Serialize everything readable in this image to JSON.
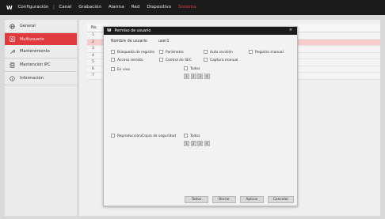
{
  "topbar": {
    "logo": "W",
    "nav": [
      {
        "label": "Configuración",
        "active": false
      },
      {
        "label": "Canal",
        "active": false
      },
      {
        "label": "Grabación",
        "active": false
      },
      {
        "label": "Alarma",
        "active": false
      },
      {
        "label": "Red",
        "active": false
      },
      {
        "label": "Dispositivo",
        "active": false
      },
      {
        "label": "Sistema",
        "active": true
      }
    ]
  },
  "sidebar": {
    "items": [
      {
        "label": "General",
        "icon": "globe-icon"
      },
      {
        "label": "Multiusuario",
        "icon": "user-icon",
        "active": true
      },
      {
        "label": "Mantenimiento",
        "icon": "wrench-icon"
      },
      {
        "label": "Mantención IPC",
        "icon": "ipc-icon"
      },
      {
        "label": "Información",
        "icon": "info-icon"
      }
    ]
  },
  "table": {
    "header": "No.",
    "rows": [
      "1",
      "2",
      "3",
      "4",
      "5",
      "6",
      "7"
    ],
    "selected_index": 1
  },
  "modal": {
    "logo": "W",
    "title": "Permiso de usuario",
    "close": "×",
    "username_label": "Nombre de usuario",
    "username_value": "user1",
    "permissions": {
      "search_record": "Búsqueda de registro",
      "parameter": "Parámetro",
      "auto_seq": "Auto revisión",
      "manual_record": "Registro manual",
      "remote_access": "Acceso remoto",
      "ptz_control": "Control de SEC",
      "manual_capture": "Captura manual",
      "live": "En vivo",
      "all_live": "Todos",
      "playback": "Reproducción/Copia de seguridad",
      "all_playback": "Todos"
    },
    "channels_live": [
      "1",
      "2",
      "3",
      "4"
    ],
    "channels_playback": [
      "1",
      "2",
      "3",
      "4"
    ],
    "buttons": {
      "all": "Todos",
      "clear": "Borrar",
      "apply": "Aplicar",
      "cancel": "Cancelar"
    }
  },
  "colors": {
    "accent": "#e0393e",
    "topbar": "#1b1b1b"
  }
}
